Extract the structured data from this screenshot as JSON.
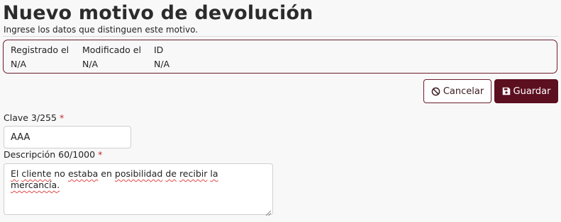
{
  "header": {
    "title": "Nuevo motivo de devolución",
    "subtitle": "Ingrese los datos que distinguen este motivo."
  },
  "meta": {
    "fields": [
      {
        "label": "Registrado el",
        "value": "N/A"
      },
      {
        "label": "Modificado el",
        "value": "N/A"
      },
      {
        "label": "ID",
        "value": "N/A"
      }
    ]
  },
  "actions": {
    "cancel_label": "Cancelar",
    "save_label": "Guardar"
  },
  "form": {
    "clave": {
      "label": "Clave 3/255",
      "required_mark": "*",
      "value": "AAA"
    },
    "descripcion": {
      "label": "Descripción 60/1000",
      "required_mark": "*",
      "value_words": [
        "El",
        "cliente",
        "no",
        "estaba",
        "en",
        "posibilidad",
        "de",
        "recibir",
        "la",
        "mercancía."
      ]
    }
  },
  "colors": {
    "accent": "#5c0f1f",
    "border_accent": "#6b1d2b",
    "required": "#c62828"
  }
}
